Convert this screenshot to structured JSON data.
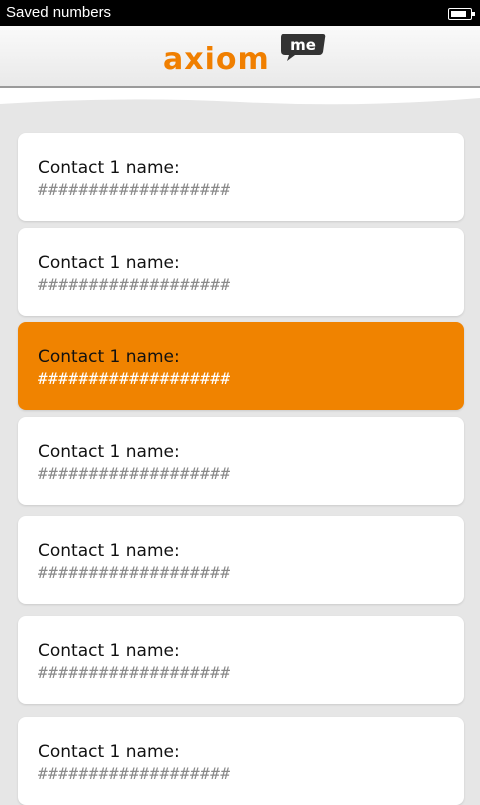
{
  "status_bar": {
    "title": "Saved numbers",
    "battery_icon": "battery-icon",
    "battery_level": 0.85
  },
  "header": {
    "logo_text": "axiom",
    "logo_badge": "me",
    "brand_color": "#f07f00"
  },
  "contacts": [
    {
      "name": "Contact 1 name:",
      "number": "###################",
      "selected": false
    },
    {
      "name": "Contact 1 name:",
      "number": "###################",
      "selected": false
    },
    {
      "name": "Contact 1 name:",
      "number": "###################",
      "selected": true
    },
    {
      "name": "Contact 1 name:",
      "number": "###################",
      "selected": false
    },
    {
      "name": "Contact 1 name:",
      "number": "###################",
      "selected": false
    },
    {
      "name": "Contact 1 name:",
      "number": "###################",
      "selected": false
    },
    {
      "name": "Contact 1 name:",
      "number": "###################",
      "selected": false
    }
  ],
  "colors": {
    "accent": "#f08300",
    "background": "#e6e6e6",
    "card": "#ffffff"
  }
}
